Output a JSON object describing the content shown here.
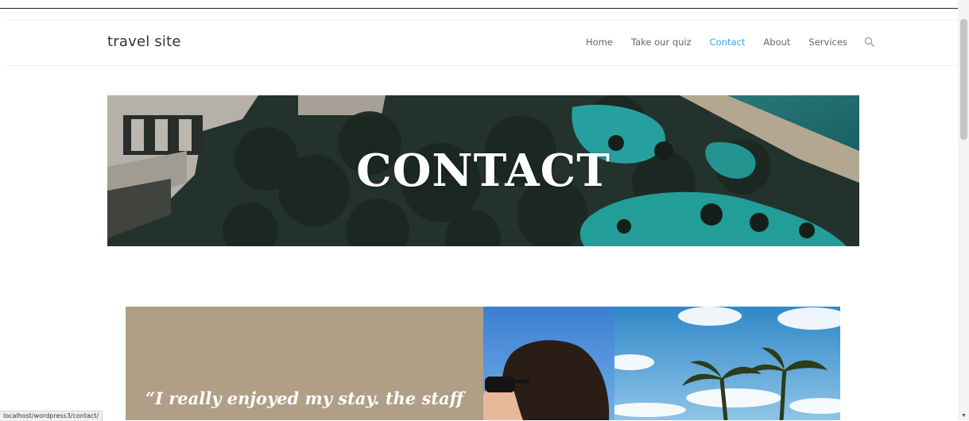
{
  "site": {
    "title": "travel site"
  },
  "nav": {
    "items": [
      {
        "label": "Home",
        "active": false
      },
      {
        "label": "Take our quiz",
        "active": false
      },
      {
        "label": "Contact",
        "active": true
      },
      {
        "label": "About",
        "active": false
      },
      {
        "label": "Services",
        "active": false
      }
    ],
    "search_icon": "search-icon",
    "active_color": "#3aa6dd"
  },
  "hero": {
    "title": "CONTACT"
  },
  "testimonial": {
    "quote": "“I really enjoyed my stay. the staff",
    "background_color": "#b09e86"
  },
  "statusbar": {
    "url": "localhost/wordpress3/contact/"
  }
}
